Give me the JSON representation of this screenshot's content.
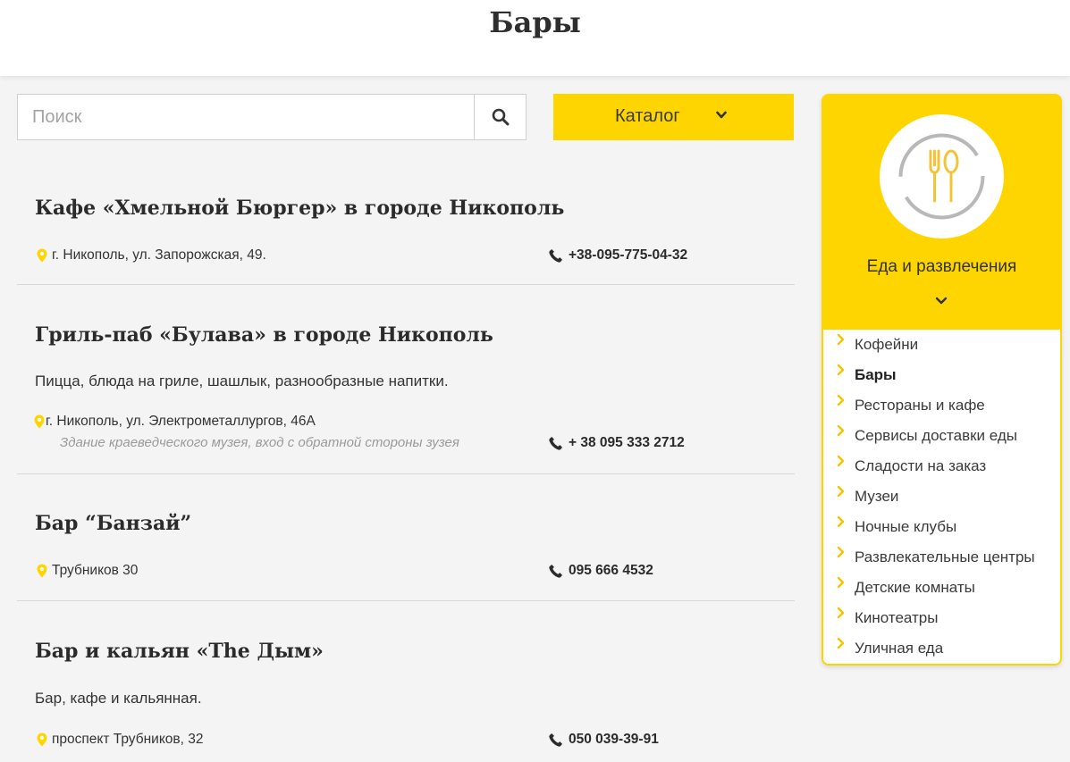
{
  "page": {
    "title": "Бары"
  },
  "search": {
    "placeholder": "Поиск"
  },
  "catalog": {
    "label": "Каталог"
  },
  "listings": [
    {
      "title": "Кафе «Хмельной Бюргер» в городе Никополь",
      "description": "",
      "address": "г. Никополь, ул. Запорожская, 49.",
      "note": "",
      "phone": "+38-095-775-04-32"
    },
    {
      "title": "Гриль-паб «Булава» в городе Никополь",
      "description": "Пицца, блюда на гриле, шашлык, разнообразные напитки.",
      "address": "г. Никополь, ул. Электрометаллургов, 46А",
      "note": "Здание краеведческого музея, вход с обратной стороны зузея",
      "phone": "+ 38 095 333 2712"
    },
    {
      "title": "Бар “Банзай”",
      "description": "",
      "address": "Трубников 30",
      "note": "",
      "phone": "095 666 4532"
    },
    {
      "title": "Бар и кальян «The Дым»",
      "description": "Бар, кафе и кальянная.",
      "address": "проспект Трубников, 32",
      "note": "",
      "phone": "050 039-39-91"
    }
  ],
  "sidebar": {
    "category": "Еда и развлечения",
    "items": [
      {
        "label": "Кофейни",
        "active": false
      },
      {
        "label": "Бары",
        "active": true
      },
      {
        "label": "Рестораны и кафе",
        "active": false
      },
      {
        "label": "Сервисы доставки еды",
        "active": false
      },
      {
        "label": "Сладости на заказ",
        "active": false
      },
      {
        "label": "Музеи",
        "active": false
      },
      {
        "label": "Ночные клубы",
        "active": false
      },
      {
        "label": "Развлекательные центры",
        "active": false
      },
      {
        "label": "Детские комнаты",
        "active": false
      },
      {
        "label": "Кинотеатры",
        "active": false
      },
      {
        "label": "Уличная еда",
        "active": false
      }
    ]
  },
  "colors": {
    "accent": "#ffd500",
    "background": "#f4f4f4",
    "text": "#2b2b2b",
    "muted": "#9a9a9a"
  },
  "icons": {
    "search": "search-icon",
    "chevron": "chevron-down-icon",
    "pin": "map-pin-icon",
    "phone": "phone-icon",
    "category": "cutlery-icon",
    "item": "chevron-right-icon"
  }
}
